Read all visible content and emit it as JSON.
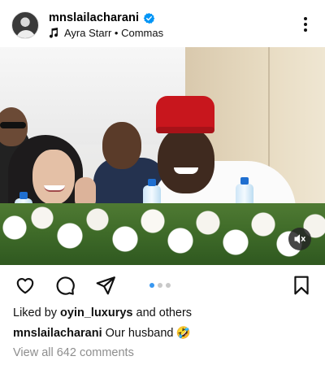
{
  "post": {
    "username": "mnslailacharani",
    "verified": true,
    "music": {
      "artist": "Ayra Starr",
      "separator": "•",
      "track": "Commas"
    }
  },
  "media": {
    "carousel_count": 3,
    "active_index": 0,
    "audio_state": "muted"
  },
  "engagement": {
    "liked_by_prefix": "Liked by",
    "liked_by_user": "oyin_luxurys",
    "liked_by_suffix": "and others"
  },
  "caption": {
    "username": "mnslailacharani",
    "text": "Our husband",
    "emoji": "🤣"
  },
  "comments": {
    "view_all_label": "View all 642 comments"
  },
  "colors": {
    "verified_blue": "#0095f6",
    "active_dot": "#3897f0",
    "muted_text": "#8e8e8e"
  },
  "icons": {
    "like": "heart-icon",
    "comment": "comment-icon",
    "share": "paper-plane-icon",
    "save": "bookmark-icon",
    "more": "more-vertical-icon",
    "music": "music-note-icon",
    "audio": "speaker-muted-icon"
  }
}
